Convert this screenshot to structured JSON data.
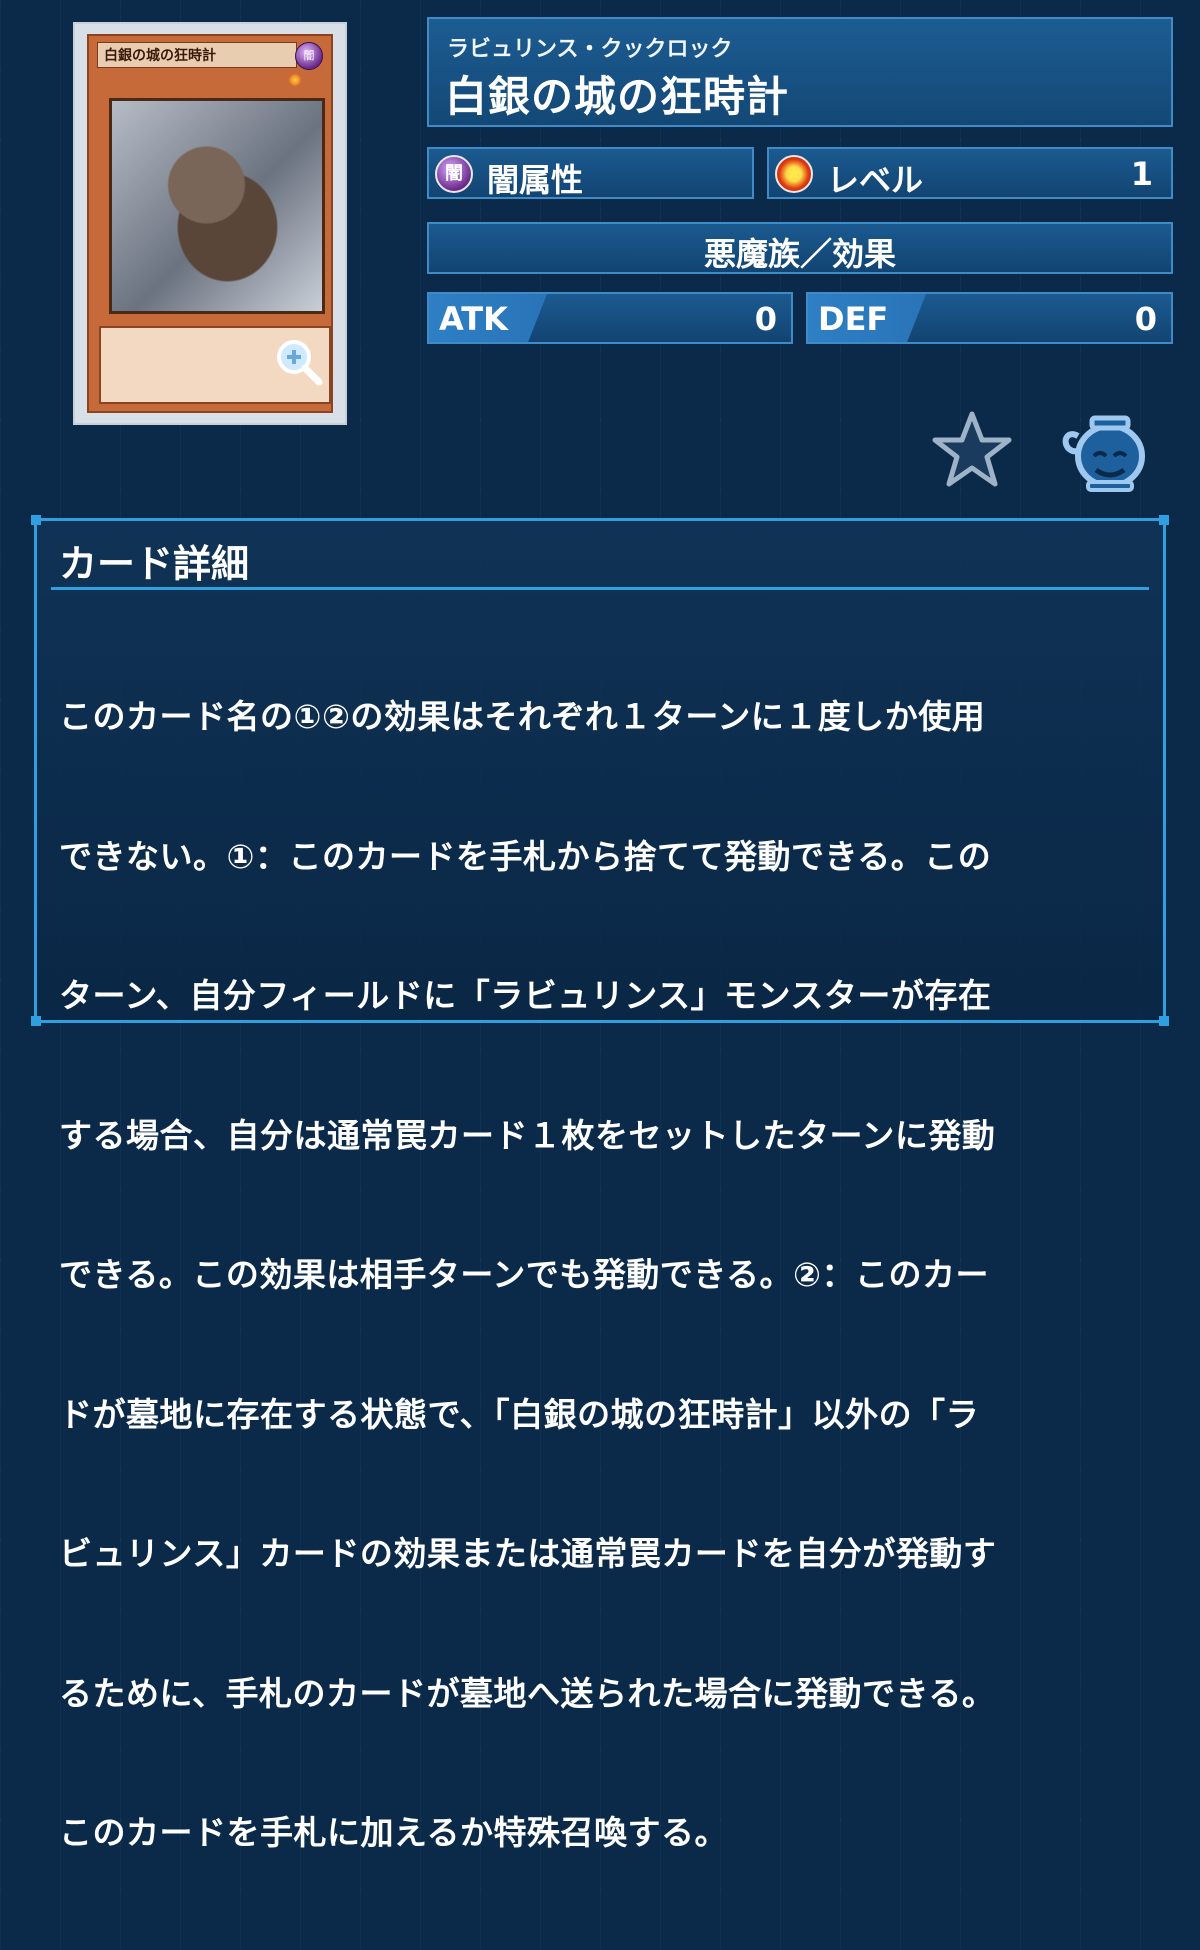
{
  "card_image": {
    "name_text": "白銀の城の狂時計",
    "attribute_glyph": "闇"
  },
  "header": {
    "ruby": "ラビュリンス・クックロック",
    "title": "白銀の城の狂時計"
  },
  "attribute": {
    "icon_glyph": "闇",
    "label": "闇属性"
  },
  "level": {
    "label": "レベル",
    "value": "1"
  },
  "type": {
    "label": "悪魔族／効果"
  },
  "stats": {
    "atk_label": "ATK",
    "atk_value": "0",
    "def_label": "DEF",
    "def_value": "0"
  },
  "detail": {
    "heading": "カード詳細",
    "lines": [
      "このカード名の①②の効果はそれぞれ１ターンに１度しか使用",
      "できない。①：このカードを手札から捨てて発動できる。この",
      "ターン、自分フィールドに「ラビュリンス」モンスターが存在",
      "する場合、自分は通常罠カード１枚をセットしたターンに発動",
      "できる。この効果は相手ターンでも発動できる。②：このカー",
      "ドが墓地に存在する状態で、「白銀の城の狂時計」以外の「ラ",
      "ビュリンス」カードの効果または通常罠カードを自分が発動す",
      "るために、手札のカードが墓地へ送られた場合に発動できる。",
      "このカードを手札に加えるか特殊召喚する。"
    ]
  },
  "colors": {
    "background": "#0b2a4a",
    "border_accent": "#2f9fe0",
    "panel_blue": "#1b5a90"
  },
  "icons": [
    "zoom-icon",
    "favorite-star-icon",
    "pot-of-greed-icon",
    "dark-attribute-icon",
    "level-star-icon"
  ]
}
